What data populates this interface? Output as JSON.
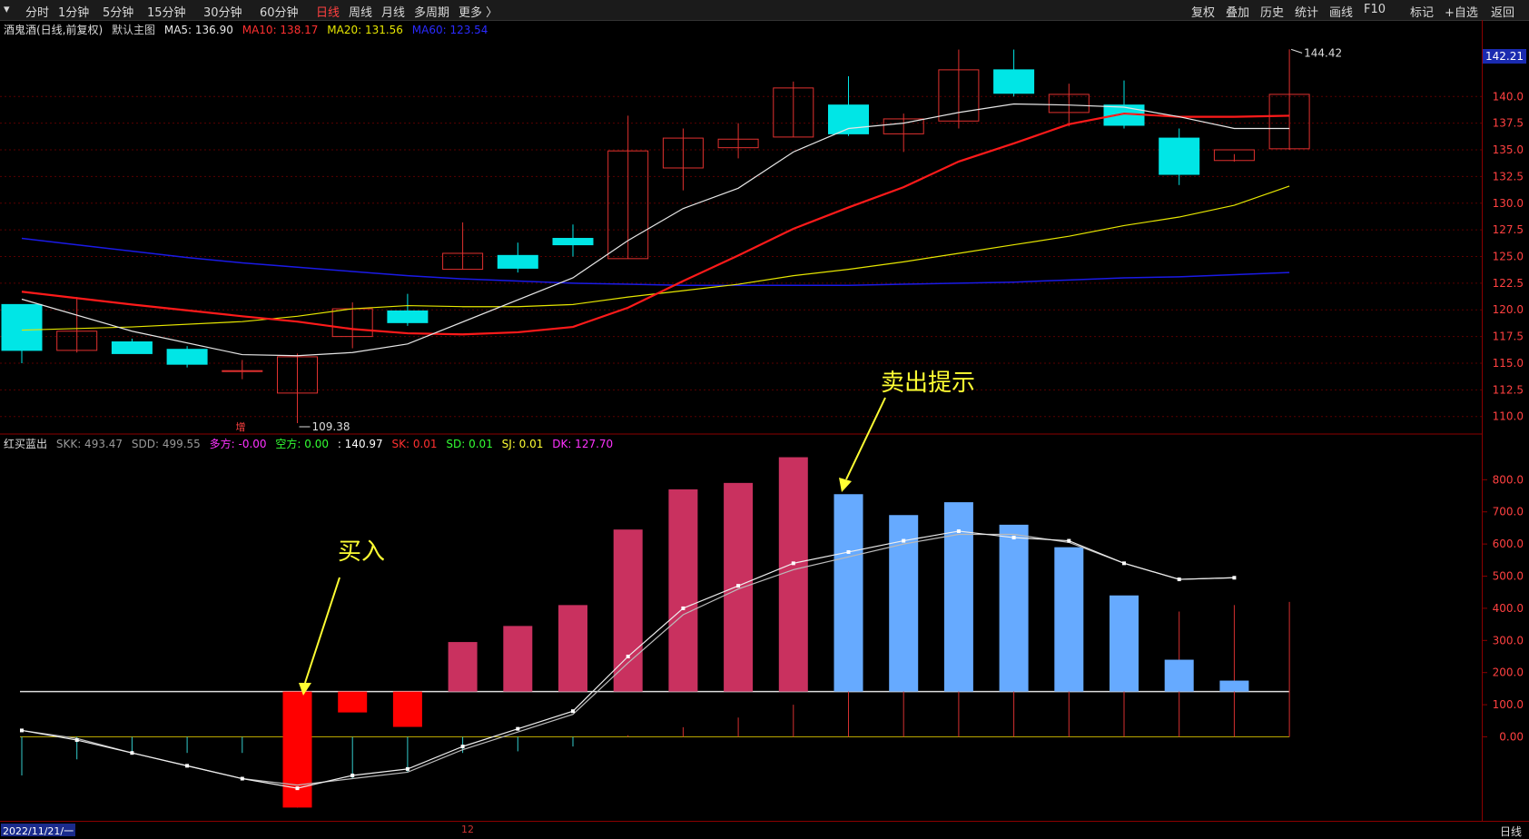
{
  "toolbar": {
    "left_items": [
      {
        "label": "分时"
      },
      {
        "label": "1分钟"
      },
      {
        "label": "5分钟"
      },
      {
        "label": "15分钟"
      },
      {
        "label": "30分钟"
      },
      {
        "label": "60分钟"
      },
      {
        "label": "日线",
        "active": true
      },
      {
        "label": "周线"
      },
      {
        "label": "月线"
      },
      {
        "label": "多周期"
      },
      {
        "label": "更多 〉"
      }
    ],
    "right_items": [
      {
        "label": "复权"
      },
      {
        "label": "叠加"
      },
      {
        "label": "历史"
      },
      {
        "label": "统计"
      },
      {
        "label": "画线"
      },
      {
        "label": "F10"
      },
      {
        "label": "标记"
      },
      {
        "label": "+自选"
      },
      {
        "label": "返回"
      }
    ]
  },
  "main_info": {
    "title": "酒鬼酒(日线,前复权)",
    "template": "默认主图",
    "ma5": "MA5: 136.90",
    "ma10": "MA10: 138.17",
    "ma20": "MA20: 131.56",
    "ma60": "MA60: 123.54"
  },
  "indicator_info": {
    "name": "红买蓝出",
    "skk": "SKK: 493.47",
    "sdd": "SDD: 499.55",
    "duofang": "多方: -0.00",
    "kongfang": "空方: 0.00",
    "value": ": 140.97",
    "sk": "SK: 0.01",
    "sd": "SD: 0.01",
    "sj": "SJ: 0.01",
    "dk": "DK: 127.70"
  },
  "colors": {
    "up": "#e0312f",
    "down": "#00e6e6",
    "ma5": "#e6e6e6",
    "ma10": "#ff1a1a",
    "ma20": "#e6e600",
    "ma60": "#1a1ae6",
    "red_bar": "#c9315f",
    "blue_bar": "#66aaff",
    "buy_bar": "#ff0000",
    "annotation": "#ffff33"
  },
  "annotations": {
    "buy": "买入",
    "sell": "卖出提示",
    "zeng": "增"
  },
  "price_badge": "142.21",
  "high_label": "144.42",
  "low_label": "109.38",
  "price_axis_labels": [
    "140.0",
    "137.5",
    "135.0",
    "132.5",
    "130.0",
    "127.5",
    "125.0",
    "122.5",
    "120.0",
    "117.5",
    "115.0",
    "112.5",
    "110.0"
  ],
  "indicator_axis_labels": [
    "800.0",
    "700.0",
    "600.0",
    "500.0",
    "400.0",
    "300.0",
    "200.0",
    "100.0",
    "0.00"
  ],
  "statusbar": {
    "date": "2022/11/21/一",
    "mid": "12",
    "period": "日线"
  },
  "chart_data": [
    {
      "type": "candlestick",
      "candles": [
        {
          "o": 120.5,
          "h": 120.5,
          "l": 115.0,
          "c": 116.2
        },
        {
          "o": 116.2,
          "h": 121.2,
          "l": 116.0,
          "c": 118.0
        },
        {
          "o": 117.0,
          "h": 117.3,
          "l": 115.9,
          "c": 115.9
        },
        {
          "o": 116.3,
          "h": 116.6,
          "l": 114.6,
          "c": 114.9
        },
        {
          "o": 114.3,
          "h": 115.3,
          "l": 113.5,
          "c": 114.3
        },
        {
          "o": 112.2,
          "h": 115.9,
          "l": 109.38,
          "c": 115.6
        },
        {
          "o": 117.5,
          "h": 120.7,
          "l": 116.4,
          "c": 120.1
        },
        {
          "o": 119.9,
          "h": 121.5,
          "l": 118.5,
          "c": 118.8
        },
        {
          "o": 123.8,
          "h": 128.2,
          "l": 123.8,
          "c": 125.3
        },
        {
          "o": 125.1,
          "h": 126.3,
          "l": 123.5,
          "c": 123.9
        },
        {
          "o": 126.7,
          "h": 128.0,
          "l": 125.0,
          "c": 126.1
        },
        {
          "o": 124.8,
          "h": 138.2,
          "l": 124.8,
          "c": 134.9
        },
        {
          "o": 133.3,
          "h": 137.0,
          "l": 131.2,
          "c": 136.1
        },
        {
          "o": 135.2,
          "h": 137.5,
          "l": 134.2,
          "c": 136.0
        },
        {
          "o": 136.2,
          "h": 141.4,
          "l": 136.2,
          "c": 140.8
        },
        {
          "o": 139.2,
          "h": 141.9,
          "l": 136.3,
          "c": 136.5
        },
        {
          "o": 136.5,
          "h": 138.4,
          "l": 134.8,
          "c": 137.9
        },
        {
          "o": 137.7,
          "h": 144.4,
          "l": 137.0,
          "c": 142.5
        },
        {
          "o": 142.5,
          "h": 144.4,
          "l": 140.0,
          "c": 140.3
        },
        {
          "o": 138.5,
          "h": 141.2,
          "l": 137.2,
          "c": 140.2
        },
        {
          "o": 139.2,
          "h": 141.5,
          "l": 137.0,
          "c": 137.3
        },
        {
          "o": 136.1,
          "h": 137.0,
          "l": 131.7,
          "c": 132.7
        },
        {
          "o": 134.0,
          "h": 134.6,
          "l": 133.9,
          "c": 135.0
        },
        {
          "o": 135.1,
          "h": 144.42,
          "l": 135.0,
          "c": 140.2
        }
      ],
      "ma5": [
        121.0,
        null,
        118.0,
        null,
        115.8,
        115.7,
        116.0,
        116.8,
        null,
        null,
        123.0,
        126.5,
        129.5,
        131.4,
        134.8,
        137.0,
        137.5,
        138.5,
        139.3,
        139.2,
        139.0,
        138.1,
        137.0,
        137.0
      ],
      "ma10": [
        121.7,
        null,
        120.5,
        null,
        119.4,
        118.9,
        118.2,
        117.8,
        117.7,
        117.9,
        118.4,
        120.2,
        122.7,
        125.1,
        127.6,
        129.6,
        131.5,
        133.9,
        135.6,
        137.4,
        138.4,
        138.1,
        138.1,
        138.2
      ],
      "ma20": [
        118.1,
        null,
        118.4,
        null,
        118.9,
        119.4,
        120.1,
        120.4,
        120.3,
        120.3,
        120.5,
        121.2,
        121.8,
        122.4,
        123.2,
        123.8,
        124.5,
        125.3,
        126.1,
        126.9,
        127.9,
        128.7,
        129.8,
        131.6
      ],
      "ma60": [
        126.7,
        126.1,
        125.5,
        124.9,
        124.4,
        124.0,
        123.6,
        123.2,
        122.9,
        122.7,
        122.5,
        122.4,
        122.3,
        122.3,
        122.3,
        122.3,
        122.4,
        122.5,
        122.6,
        122.8,
        123.0,
        123.1,
        123.3,
        123.5
      ],
      "ylim": [
        108.7,
        145.3
      ]
    },
    {
      "type": "bar",
      "indicator": "红买蓝出",
      "values": [
        -120,
        -70,
        -50,
        -50,
        -50,
        -220,
        -130,
        -110,
        -50,
        -45,
        -30,
        5,
        30,
        60,
        100,
        160,
        220,
        270,
        310,
        340,
        370,
        390,
        410,
        420
      ],
      "signal_bars": [
        {
          "i": 5,
          "v": -220,
          "kind": "buy"
        },
        {
          "i": 6,
          "v": 65,
          "kind": "buy"
        },
        {
          "i": 7,
          "v": 110,
          "kind": "buy"
        },
        {
          "i": 8,
          "v": 295,
          "kind": "red"
        },
        {
          "i": 9,
          "v": 345,
          "kind": "red"
        },
        {
          "i": 10,
          "v": 410,
          "kind": "red"
        },
        {
          "i": 11,
          "v": 645,
          "kind": "red"
        },
        {
          "i": 12,
          "v": 770,
          "kind": "red"
        },
        {
          "i": 13,
          "v": 790,
          "kind": "red"
        },
        {
          "i": 14,
          "v": 870,
          "kind": "red"
        },
        {
          "i": 15,
          "v": 755,
          "kind": "blue"
        },
        {
          "i": 16,
          "v": 690,
          "kind": "blue"
        },
        {
          "i": 17,
          "v": 730,
          "kind": "blue"
        },
        {
          "i": 18,
          "v": 660,
          "kind": "blue"
        },
        {
          "i": 19,
          "v": 590,
          "kind": "blue"
        },
        {
          "i": 20,
          "v": 440,
          "kind": "blue"
        },
        {
          "i": 21,
          "v": 240,
          "kind": "blue"
        },
        {
          "i": 22,
          "v": 175,
          "kind": "blue"
        }
      ],
      "line1": [
        20,
        -10,
        -50,
        -90,
        -130,
        -160,
        -120,
        -100,
        -30,
        25,
        80,
        250,
        400,
        470,
        540,
        575,
        610,
        640,
        620,
        610,
        540,
        490,
        495
      ],
      "line2": [
        20,
        -5,
        -50,
        -90,
        -130,
        -150,
        -130,
        -110,
        -40,
        15,
        70,
        230,
        380,
        460,
        520,
        560,
        600,
        630,
        630,
        605,
        540,
        490,
        495
      ],
      "baseline": 140.97,
      "ylim": [
        -250,
        880
      ]
    }
  ]
}
